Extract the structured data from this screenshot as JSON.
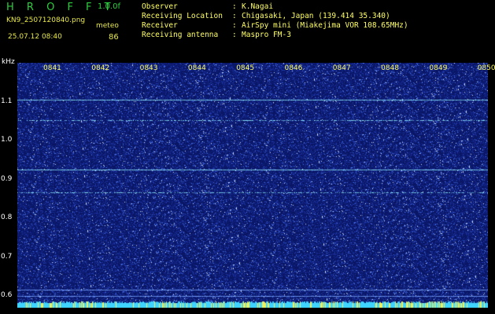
{
  "header": {
    "app_title": "H R O F F T",
    "version": "1.0.0f",
    "filename": "KN9_2507120840.png",
    "datetime": "25.07.12 08:40",
    "meteo_label": "meteo",
    "meteo_value": "86"
  },
  "info": [
    {
      "key": "Observer",
      "value": "K.Nagai"
    },
    {
      "key": "Receiving Location",
      "value": "Chigasaki, Japan (139.414 35.340)"
    },
    {
      "key": "Receiver",
      "value": "AirSpy mini (Miakejima VOR 108.65MHz)"
    },
    {
      "key": "Receiving antenna",
      "value": "Maspro FM-3"
    }
  ],
  "spectrogram": {
    "unit": "kHz",
    "time_labels": [
      "0841",
      "0842",
      "0843",
      "0844",
      "0845",
      "0846",
      "0847",
      "0848",
      "0849",
      "0850"
    ],
    "freq_labels": [
      "1.1",
      "1.0",
      "0.9",
      "0.8",
      "0.7",
      "0.6"
    ],
    "freq_values": [
      1.1,
      1.0,
      0.9,
      0.8,
      0.7,
      0.6
    ],
    "freq_range": [
      0.57,
      1.2
    ],
    "carrier_lines_khz": [
      1.105,
      1.053,
      0.925,
      0.866,
      0.617,
      0.6
    ],
    "background_color": "#0a1a6e",
    "noise_color": "#4f7dff",
    "carrier_color": "#8ff0ff"
  }
}
